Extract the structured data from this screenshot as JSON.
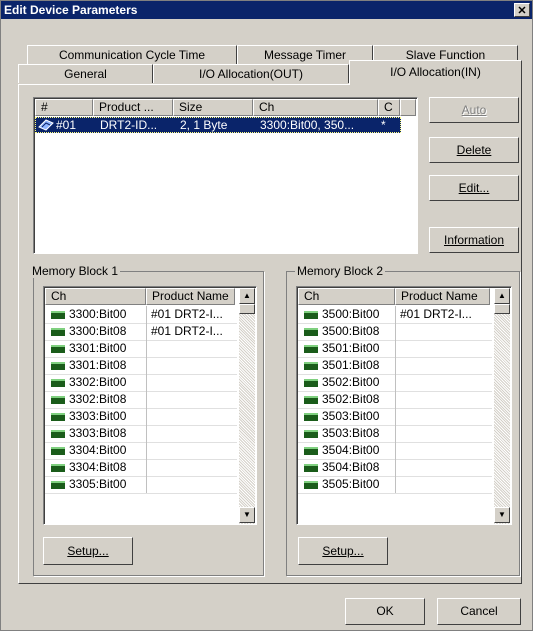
{
  "window": {
    "title": "Edit Device Parameters",
    "close_glyph": "✕"
  },
  "tabs": {
    "back_row": [
      "Communication Cycle Time",
      "Message Timer",
      "Slave Function"
    ],
    "front_row": [
      "General",
      "I/O Allocation(OUT)",
      "I/O Allocation(IN)"
    ],
    "active": "I/O Allocation(IN)"
  },
  "device_list": {
    "columns": [
      "#",
      "Product ...",
      "Size",
      "Ch",
      "C"
    ],
    "rows": [
      {
        "num": "#01",
        "product": "DRT2-ID...",
        "size": "2, 1 Byte",
        "ch": "3300:Bit00, 350...",
        "c": "*"
      }
    ],
    "icon": "device-icon"
  },
  "side_buttons": {
    "auto": "Auto",
    "delete": "Delete",
    "edit": "Edit...",
    "information": "Information"
  },
  "memory_block_1": {
    "label": "Memory Block 1",
    "columns": [
      "Ch",
      "Product Name"
    ],
    "rows": [
      {
        "ch": "3300:Bit00",
        "product": "#01 DRT2-I..."
      },
      {
        "ch": "3300:Bit08",
        "product": "#01 DRT2-I..."
      },
      {
        "ch": "3301:Bit00",
        "product": ""
      },
      {
        "ch": "3301:Bit08",
        "product": ""
      },
      {
        "ch": "3302:Bit00",
        "product": ""
      },
      {
        "ch": "3302:Bit08",
        "product": ""
      },
      {
        "ch": "3303:Bit00",
        "product": ""
      },
      {
        "ch": "3303:Bit08",
        "product": ""
      },
      {
        "ch": "3304:Bit00",
        "product": ""
      },
      {
        "ch": "3304:Bit08",
        "product": ""
      },
      {
        "ch": "3305:Bit00",
        "product": ""
      }
    ],
    "setup": "Setup..."
  },
  "memory_block_2": {
    "label": "Memory Block 2",
    "columns": [
      "Ch",
      "Product Name"
    ],
    "rows": [
      {
        "ch": "3500:Bit00",
        "product": "#01 DRT2-I..."
      },
      {
        "ch": "3500:Bit08",
        "product": ""
      },
      {
        "ch": "3501:Bit00",
        "product": ""
      },
      {
        "ch": "3501:Bit08",
        "product": ""
      },
      {
        "ch": "3502:Bit00",
        "product": ""
      },
      {
        "ch": "3502:Bit08",
        "product": ""
      },
      {
        "ch": "3503:Bit00",
        "product": ""
      },
      {
        "ch": "3503:Bit08",
        "product": ""
      },
      {
        "ch": "3504:Bit00",
        "product": ""
      },
      {
        "ch": "3504:Bit08",
        "product": ""
      },
      {
        "ch": "3505:Bit00",
        "product": ""
      }
    ],
    "setup": "Setup..."
  },
  "footer": {
    "ok": "OK",
    "cancel": "Cancel"
  },
  "colors": {
    "titlebar": "#0a246a",
    "selection": "#0a246a",
    "face": "#d4d0c8",
    "memory_icon": "#1a5c1a"
  }
}
